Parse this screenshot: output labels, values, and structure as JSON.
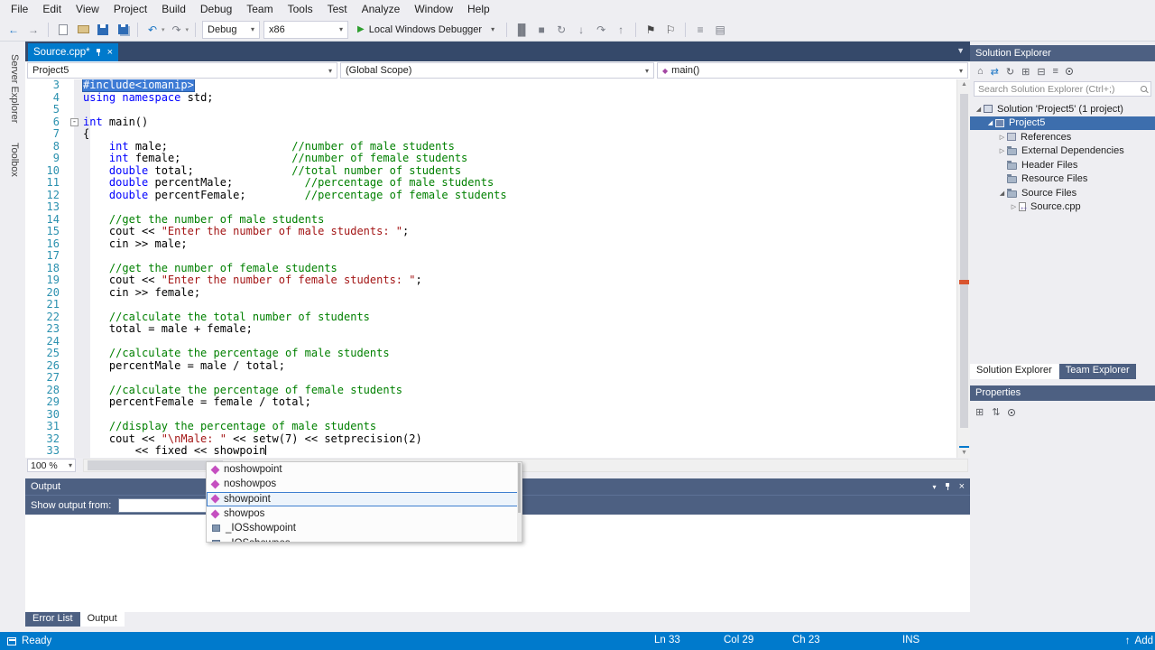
{
  "menu": {
    "items": [
      "File",
      "Edit",
      "View",
      "Project",
      "Build",
      "Debug",
      "Team",
      "Tools",
      "Test",
      "Analyze",
      "Window",
      "Help"
    ]
  },
  "toolbar": {
    "debug_config": "Debug",
    "platform": "x86",
    "run_label": "Local Windows Debugger"
  },
  "side_strip": {
    "server_explorer": "Server Explorer",
    "toolbox": "Toolbox"
  },
  "editor": {
    "tab_title": "Source.cpp*",
    "breadcrumb": {
      "project": "Project5",
      "scope": "(Global Scope)",
      "member": "main()"
    },
    "zoom_level": "100 %",
    "code_lines": [
      {
        "n": 3,
        "segs": [
          [
            "#include<iomanip>",
            "sel"
          ]
        ]
      },
      {
        "n": 4,
        "segs": [
          [
            "using",
            "k"
          ],
          [
            " ",
            "p"
          ],
          [
            "namespace",
            "k"
          ],
          [
            " std;",
            "p"
          ]
        ]
      },
      {
        "n": 5,
        "segs": []
      },
      {
        "n": 6,
        "fold": true,
        "segs": [
          [
            "int",
            "k"
          ],
          [
            " main()",
            "p"
          ]
        ]
      },
      {
        "n": 7,
        "segs": [
          [
            "{",
            "p"
          ]
        ]
      },
      {
        "n": 8,
        "segs": [
          [
            "    ",
            "p"
          ],
          [
            "int",
            "k"
          ],
          [
            " male;                   ",
            "p"
          ],
          [
            "//number of male students",
            "c"
          ]
        ]
      },
      {
        "n": 9,
        "segs": [
          [
            "    ",
            "p"
          ],
          [
            "int",
            "k"
          ],
          [
            " female;                 ",
            "p"
          ],
          [
            "//number of female students",
            "c"
          ]
        ]
      },
      {
        "n": 10,
        "segs": [
          [
            "    ",
            "p"
          ],
          [
            "double",
            "k"
          ],
          [
            " total;               ",
            "p"
          ],
          [
            "//total number of students",
            "c"
          ]
        ]
      },
      {
        "n": 11,
        "segs": [
          [
            "    ",
            "p"
          ],
          [
            "double",
            "k"
          ],
          [
            " percentMale;           ",
            "p"
          ],
          [
            "//percentage of male students",
            "c"
          ]
        ]
      },
      {
        "n": 12,
        "segs": [
          [
            "    ",
            "p"
          ],
          [
            "double",
            "k"
          ],
          [
            " percentFemale;         ",
            "p"
          ],
          [
            "//percentage of female students",
            "c"
          ]
        ]
      },
      {
        "n": 13,
        "segs": []
      },
      {
        "n": 14,
        "segs": [
          [
            "    ",
            "p"
          ],
          [
            "//get the number of male students",
            "c"
          ]
        ]
      },
      {
        "n": 15,
        "segs": [
          [
            "    cout << ",
            "p"
          ],
          [
            "\"Enter the number of male students: \"",
            "s"
          ],
          [
            ";",
            "p"
          ]
        ]
      },
      {
        "n": 16,
        "segs": [
          [
            "    cin >> male;",
            "p"
          ]
        ]
      },
      {
        "n": 17,
        "segs": []
      },
      {
        "n": 18,
        "segs": [
          [
            "    ",
            "p"
          ],
          [
            "//get the number of female students",
            "c"
          ]
        ]
      },
      {
        "n": 19,
        "segs": [
          [
            "    cout << ",
            "p"
          ],
          [
            "\"Enter the number of female students: \"",
            "s"
          ],
          [
            ";",
            "p"
          ]
        ]
      },
      {
        "n": 20,
        "segs": [
          [
            "    cin >> female;",
            "p"
          ]
        ]
      },
      {
        "n": 21,
        "segs": []
      },
      {
        "n": 22,
        "segs": [
          [
            "    ",
            "p"
          ],
          [
            "//calculate the total number of students",
            "c"
          ]
        ]
      },
      {
        "n": 23,
        "segs": [
          [
            "    total = male + female;",
            "p"
          ]
        ]
      },
      {
        "n": 24,
        "segs": []
      },
      {
        "n": 25,
        "segs": [
          [
            "    ",
            "p"
          ],
          [
            "//calculate the percentage of male students",
            "c"
          ]
        ]
      },
      {
        "n": 26,
        "segs": [
          [
            "    percentMale = male / total;",
            "p"
          ]
        ]
      },
      {
        "n": 27,
        "segs": []
      },
      {
        "n": 28,
        "segs": [
          [
            "    ",
            "p"
          ],
          [
            "//calculate the percentage of female students",
            "c"
          ]
        ]
      },
      {
        "n": 29,
        "segs": [
          [
            "    percentFemale = female / total;",
            "p"
          ]
        ]
      },
      {
        "n": 30,
        "segs": []
      },
      {
        "n": 31,
        "segs": [
          [
            "    ",
            "p"
          ],
          [
            "//display the percentage of male students",
            "c"
          ]
        ]
      },
      {
        "n": 32,
        "segs": [
          [
            "    cout << ",
            "p"
          ],
          [
            "\"\\nMale: \"",
            "s"
          ],
          [
            " << setw(7) << setprecision(2)",
            "p"
          ]
        ]
      },
      {
        "n": 33,
        "caret": true,
        "segs": [
          [
            "        << fixed << showpoin",
            "p"
          ]
        ]
      }
    ]
  },
  "completion": {
    "items": [
      {
        "label": "noshowpoint",
        "kind": "manip",
        "selected": false
      },
      {
        "label": "noshowpos",
        "kind": "manip",
        "selected": false
      },
      {
        "label": "showpoint",
        "kind": "manip",
        "selected": true
      },
      {
        "label": "showpos",
        "kind": "manip",
        "selected": false
      },
      {
        "label": "_IOSshowpoint",
        "kind": "enum",
        "selected": false
      },
      {
        "label": "_IOSshowpos",
        "kind": "enum",
        "selected": false
      }
    ]
  },
  "output_window": {
    "title": "Output",
    "show_output_from": "Show output from:"
  },
  "bottom_tabs": [
    {
      "label": "Error List",
      "active": false
    },
    {
      "label": "Output",
      "active": true
    }
  ],
  "solution_explorer": {
    "title": "Solution Explorer",
    "search_placeholder": "Search Solution Explorer (Ctrl+;)",
    "tree": [
      {
        "label": "Solution 'Project5' (1 project)",
        "indent": 0,
        "arrow": "expanded",
        "icon": "solution",
        "selected": false
      },
      {
        "label": "Project5",
        "indent": 1,
        "arrow": "expanded",
        "icon": "project",
        "selected": true
      },
      {
        "label": "References",
        "indent": 2,
        "arrow": "collapsed",
        "icon": "references",
        "selected": false
      },
      {
        "label": "External Dependencies",
        "indent": 2,
        "arrow": "collapsed",
        "icon": "folder",
        "selected": false
      },
      {
        "label": "Header Files",
        "indent": 2,
        "arrow": "none",
        "icon": "folder",
        "selected": false
      },
      {
        "label": "Resource Files",
        "indent": 2,
        "arrow": "none",
        "icon": "folder",
        "selected": false
      },
      {
        "label": "Source Files",
        "indent": 2,
        "arrow": "expanded",
        "icon": "folder",
        "selected": false
      },
      {
        "label": "Source.cpp",
        "indent": 3,
        "arrow": "collapsed",
        "icon": "cpp",
        "selected": false
      }
    ],
    "panel_tabs": [
      {
        "label": "Solution Explorer",
        "active": true
      },
      {
        "label": "Team Explorer",
        "active": false
      }
    ]
  },
  "properties_panel": {
    "title": "Properties"
  },
  "status_bar": {
    "state": "Ready",
    "line": "Ln 33",
    "column": "Col 29",
    "character": "Ch 23",
    "mode": "INS",
    "source_control": "Add"
  },
  "colors": {
    "accent": "#007ACC",
    "tool_window_title": "#4D6082",
    "tab_strip": "#35496A",
    "keyword": "#0000FF",
    "comment": "#008000",
    "string": "#A31515",
    "line_number": "#2B91AF",
    "selection": "#3D7BD5"
  }
}
